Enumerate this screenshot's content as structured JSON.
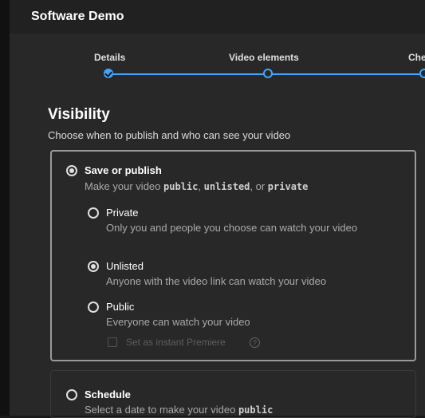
{
  "app": {
    "title": "Software Demo"
  },
  "stepper": {
    "steps": [
      {
        "label": "Details",
        "state": "done"
      },
      {
        "label": "Video elements",
        "state": "current"
      },
      {
        "label": "Che",
        "state": "current"
      }
    ],
    "accent": "#3ea6ff"
  },
  "visibility": {
    "heading": "Visibility",
    "subheading": "Choose when to publish and who can see your video",
    "save_or_publish": {
      "title": "Save or publish",
      "desc_prefix": "Make your video ",
      "kw_public": "public",
      "sep1": ", ",
      "kw_unlisted": "unlisted",
      "sep2": ", or ",
      "kw_private": "private",
      "selected": true
    },
    "options": [
      {
        "title": "Private",
        "desc": "Only you and people you choose can watch your video",
        "selected": false
      },
      {
        "title": "Unlisted",
        "desc": "Anyone with the video link can watch your video",
        "selected": true
      },
      {
        "title": "Public",
        "desc": "Everyone can watch your video",
        "selected": false
      }
    ],
    "premiere": {
      "label": "Set as instant Premiere",
      "checked": false
    },
    "schedule": {
      "title": "Schedule",
      "desc_prefix": "Select a date to make your video ",
      "kw_public": "public",
      "selected": false
    }
  }
}
